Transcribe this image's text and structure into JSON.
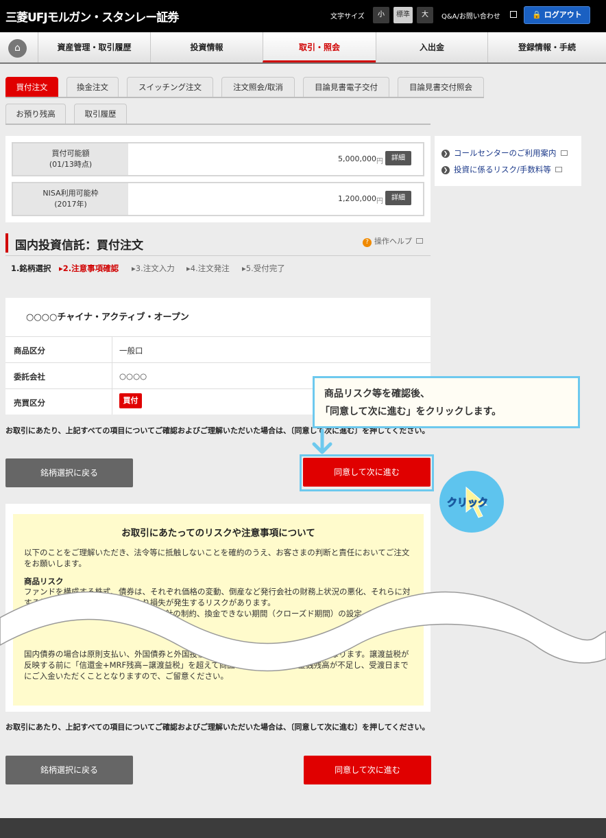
{
  "header": {
    "logo": "三菱UFJモルガン・スタンレー証券",
    "font_size_label": "文字サイズ",
    "font_sizes": [
      "小",
      "標準",
      "大"
    ],
    "faq": "Q&A/お問い合わせ",
    "logout": "ログアウト"
  },
  "nav": {
    "items": [
      "資産管理・取引履歴",
      "投資情報",
      "取引・照会",
      "入出金",
      "登録情報・手続"
    ],
    "active": "取引・照会"
  },
  "subtabs": {
    "row1": [
      "買付注文",
      "換金注文",
      "スイッチング注文",
      "注文照会/取消",
      "目論見書電子交付",
      "目論見書交付照会"
    ],
    "row2": [
      "お預り残高",
      "取引履歴"
    ],
    "active": "買付注文"
  },
  "balance": {
    "rows": [
      {
        "label1": "買付可能額",
        "label2": "(01/13時点)",
        "value": "5,000,000",
        "unit": "円",
        "detail": "詳細"
      },
      {
        "label1": "NISA利用可能枠",
        "label2": "(2017年)",
        "value": "1,200,000",
        "unit": "円",
        "detail": "詳細"
      }
    ]
  },
  "side_links": [
    "コールセンターのご利用案内",
    "投資に係るリスク/手数料等"
  ],
  "page": {
    "title": "国内投資信託：買付注文",
    "help": "操作ヘルプ"
  },
  "steps": [
    "1.銘柄選択",
    "2.注意事項確認",
    "3.注文入力",
    "4.注文発注",
    "5.受付完了"
  ],
  "product": {
    "name": "○○○○チャイナ・アクティブ・オープン",
    "rows": [
      {
        "label": "商品区分",
        "value": "一般口"
      },
      {
        "label": "委託会社",
        "value": "○○○○"
      },
      {
        "label": "売買区分",
        "value": "買付"
      }
    ]
  },
  "note": "お取引にあたり、上記すべての項目についてご確認およびご理解いただいた場合は、〔同意して次に進む〕を押してください。",
  "buttons": {
    "back": "銘柄選択に戻る",
    "next": "同意して次に進む"
  },
  "callout": {
    "line1": "商品リスク等を確認後、",
    "line2": "「同意して次に進む」をクリックします。",
    "click": "クリック"
  },
  "risk": {
    "title": "お取引にあたってのリスクや注意事項について",
    "intro": "以下のことをご理解いただき、法令等に抵触しないことを確約のうえ、お客さまの判断と責任においてご注文をお願いします。",
    "head": "商品リスク",
    "body": "ファンドを構成する株式、債券は、それぞれ価格の変動、倒産など発行会社の財務上状況の悪化、それらに対する外部評価、為替の変動等により損失が発生するリスクがあります。",
    "body2": "ファンドによっては、投資対象、投資方針の制約、換金できない期間（クローズド期間）の設定",
    "cont": "国内債券の場合は原則支払い、外国債券と外国投信は原則おいては譲渡益税が未反映となります。譲渡益税が反映する前に「信還金+MRF残高−譲渡益税」を超えて商品を購入した場合は金銭残高が不足し、受渡日までにご入金いただくこととなりますので、ご留意ください。"
  },
  "colors": {
    "accent": "#e00000",
    "link": "#1c3a8a",
    "callout_border": "#6dc9ee"
  }
}
